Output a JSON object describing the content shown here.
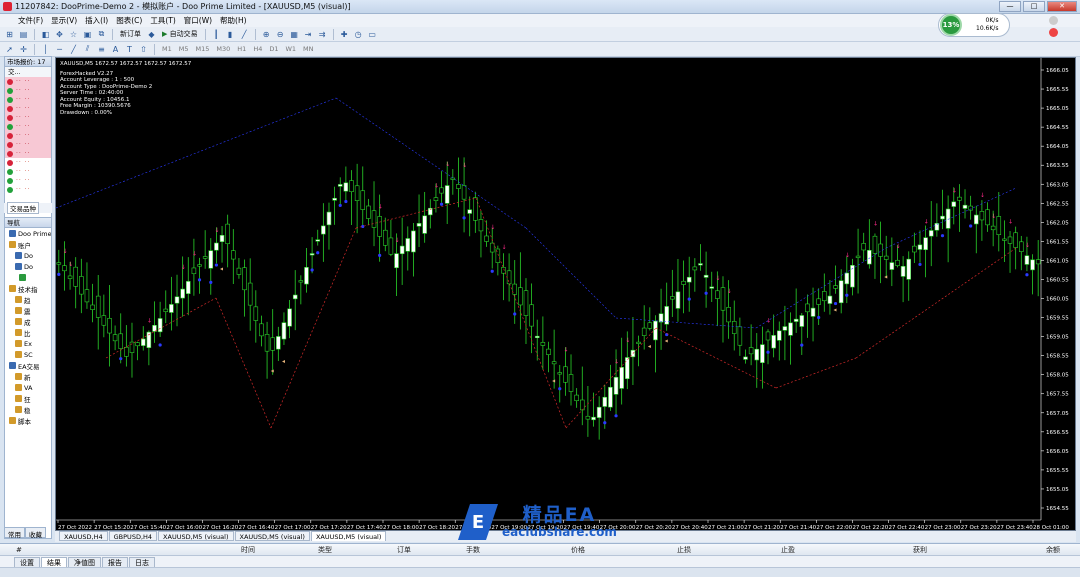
{
  "window": {
    "title": "11207842: DooPrime-Demo 2 - 模拟账户 - Doo Prime Limited - [XAUUSD,M5 (visual)]",
    "buttons": [
      "—",
      "□",
      "✕"
    ]
  },
  "menu": [
    "文件(F)",
    "显示(V)",
    "插入(I)",
    "图表(C)",
    "工具(T)",
    "窗口(W)",
    "帮助(H)"
  ],
  "toolbar1": {
    "new_order": "新订单",
    "auto_trade": "自动交易"
  },
  "toolbar2": {
    "timeframes": [
      "M1",
      "M5",
      "M15",
      "M30",
      "H1",
      "H4",
      "D1",
      "W1",
      "MN"
    ]
  },
  "network": {
    "percent": "13%",
    "up": "0K/s",
    "down": "10.6K/s"
  },
  "market_watch": {
    "header": "市场报价: 17",
    "columns": "交...",
    "rows": [
      {
        "color": "red",
        "pink": true
      },
      {
        "color": "green",
        "pink": true
      },
      {
        "color": "green",
        "pink": true
      },
      {
        "color": "red",
        "pink": true
      },
      {
        "color": "red",
        "pink": true
      },
      {
        "color": "green",
        "pink": true
      },
      {
        "color": "red",
        "pink": true
      },
      {
        "color": "red",
        "pink": true
      },
      {
        "color": "red",
        "pink": true
      },
      {
        "color": "red",
        "pink": false
      },
      {
        "color": "green",
        "pink": false
      },
      {
        "color": "green",
        "pink": false
      },
      {
        "color": "green",
        "pink": false
      }
    ],
    "tab": "交易品种"
  },
  "navigator": {
    "header": "导航",
    "items": [
      {
        "label": "Doo Prime",
        "color": "#3a6ab0"
      },
      {
        "label": "账户",
        "color": "#d29a2a"
      },
      {
        "label": "Do",
        "color": "#3a6ab0"
      },
      {
        "label": "Do",
        "color": "#3a6ab0"
      },
      {
        "label": "",
        "color": "#2a9a3e"
      },
      {
        "label": "技术指",
        "color": "#d29a2a"
      },
      {
        "label": "趋",
        "color": "#d29a2a"
      },
      {
        "label": "震",
        "color": "#d29a2a"
      },
      {
        "label": "成",
        "color": "#d29a2a"
      },
      {
        "label": "比",
        "color": "#d29a2a"
      },
      {
        "label": "Ex",
        "color": "#d29a2a"
      },
      {
        "label": "SC",
        "color": "#d29a2a"
      },
      {
        "label": "EA交易",
        "color": "#3a6ab0"
      },
      {
        "label": "新",
        "color": "#d29a2a"
      },
      {
        "label": "VA",
        "color": "#d29a2a"
      },
      {
        "label": "狂",
        "color": "#d29a2a"
      },
      {
        "label": "稳",
        "color": "#d29a2a"
      },
      {
        "label": "脚本",
        "color": "#d29a2a"
      }
    ],
    "tabs": [
      "常用",
      "收藏"
    ]
  },
  "chart": {
    "symbol_line": "XAUUSD,M5  1672.57 1672.57 1672.57 1672.57",
    "info_lines": [
      "ForexHacked V2.27",
      "Account Leverage  :  1 : 500",
      "Account Type  :  DooPrime-Demo 2",
      "Server Time  :  02:40:00",
      "Account Equity  :  10456.1",
      "Free Margin  :  10390.5676",
      "Drawdown  :  0.00%"
    ],
    "price_labels": [
      "1666.05",
      "1665.55",
      "1665.05",
      "1664.55",
      "1664.05",
      "1663.55",
      "1663.05",
      "1662.55",
      "1662.05",
      "1661.55",
      "1661.05",
      "1660.55",
      "1660.05",
      "1659.55",
      "1659.05",
      "1658.55",
      "1658.05",
      "1657.55",
      "1657.05",
      "1656.55",
      "1656.05",
      "1655.55",
      "1655.05",
      "1654.55"
    ],
    "time_labels": [
      "27 Oct 2022",
      "27 Oct 15:20",
      "27 Oct 15:40",
      "27 Oct 16:00",
      "27 Oct 16:20",
      "27 Oct 16:40",
      "27 Oct 17:00",
      "27 Oct 17:20",
      "27 Oct 17:40",
      "27 Oct 18:00",
      "27 Oct 18:20",
      "27 Oct 18:40",
      "27 Oct 19:00",
      "27 Oct 19:20",
      "27 Oct 19:40",
      "27 Oct 20:00",
      "27 Oct 20:20",
      "27 Oct 20:40",
      "27 Oct 21:00",
      "27 Oct 21:20",
      "27 Oct 21:40",
      "27 Oct 22:00",
      "27 Oct 22:20",
      "27 Oct 22:40",
      "27 Oct 23:00",
      "27 Oct 23:20",
      "27 Oct 23:40",
      "28 Oct 01:00"
    ]
  },
  "chart_tabs": [
    "XAUUSD,H4",
    "GBPUSD,H4",
    "XAUUSD,M5 (visual)",
    "XAUUSD,M5 (visual)",
    "XAUUSD,M5 (visual)"
  ],
  "terminal": {
    "columns": [
      "#",
      "时间",
      "类型",
      "订单",
      "手数",
      "价格",
      "止损",
      "止盈",
      "获利",
      "余额"
    ],
    "tabs": [
      "设置",
      "结果",
      "净值图",
      "报告",
      "日志"
    ]
  },
  "watermark": {
    "brand": "精品EA",
    "url": "eaclubshare.com"
  }
}
